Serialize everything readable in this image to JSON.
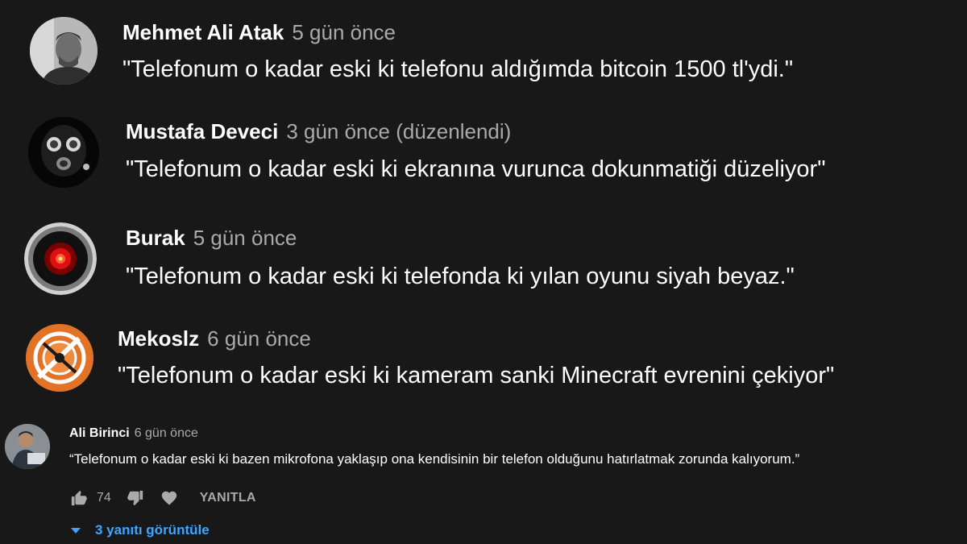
{
  "comments": [
    {
      "author": "Mehmet Ali Atak",
      "time": "5 gün önce",
      "text": "\"Telefonum o kadar eski ki telefonu aldığımda bitcoin 1500 tl'ydi.\"",
      "avatar": "man-portrait-avatar"
    },
    {
      "author": "Mustafa Deveci",
      "time": "3 gün önce (düzenlendi)",
      "text": "\"Telefonum o kadar eski ki ekranına vurunca dokunmatiği düzeliyor\"",
      "avatar": "gas-mask-avatar"
    },
    {
      "author": "Burak",
      "time": "5 gün önce",
      "text": "\"Telefonum o kadar eski ki telefonda ki yılan oyunu siyah beyaz.\"",
      "avatar": "red-eye-lens-avatar"
    },
    {
      "author": "Mekoslz",
      "time": "6 gün önce",
      "text": "\"Telefonum o kadar eski ki kameram sanki Minecraft evrenini çekiyor\"",
      "avatar": "orange-emblem-avatar"
    },
    {
      "author": "Ali Birinci",
      "time": "6 gün önce",
      "text": "“Telefonum o kadar eski ki bazen mikrofona yaklaşıp ona kendisinin bir telefon olduğunu hatırlatmak zorunda kalıyorum.”",
      "avatar": "man-laptop-avatar"
    }
  ],
  "actions": {
    "like_count": "74",
    "reply_label": "YANITLA"
  },
  "replies": {
    "label": "3 yanıtı görüntüle"
  },
  "colors": {
    "background": "#181818",
    "text": "#ffffff",
    "secondary": "#aaaaaa",
    "link": "#3ea6ff"
  }
}
